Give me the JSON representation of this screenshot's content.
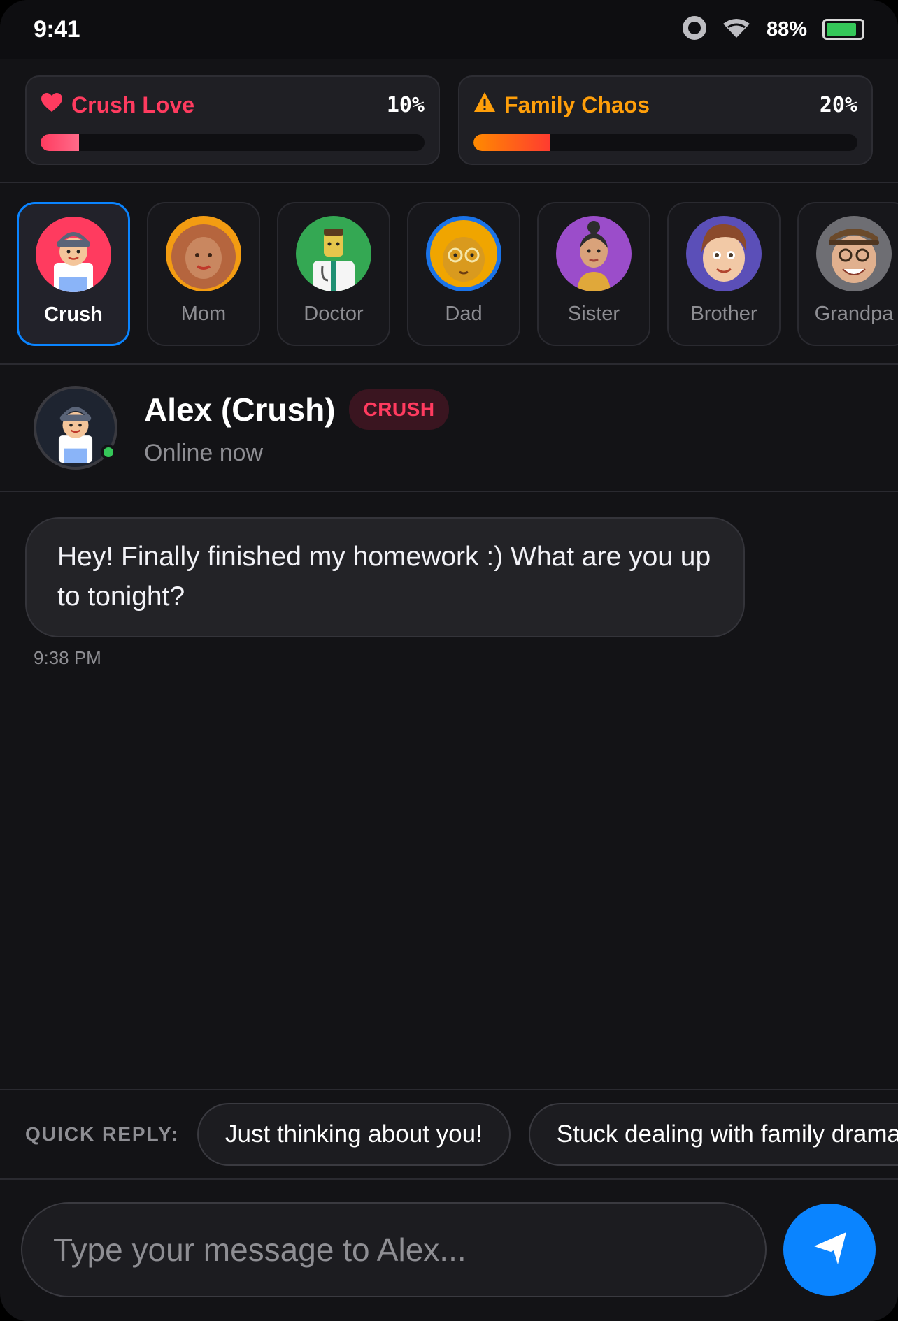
{
  "status_bar": {
    "time": "9:41",
    "battery_pct": "88%",
    "battery_level": 0.88
  },
  "meters": [
    {
      "label": "Crush Love",
      "pct_text": "10%",
      "value": 10,
      "icon": "heart-icon",
      "color": "#ff3b5f"
    },
    {
      "label": "Family Chaos",
      "pct_text": "20%",
      "value": 20,
      "icon": "warning-icon",
      "color": "#ff9f0a"
    }
  ],
  "contacts": [
    {
      "name": "Crush",
      "active": true
    },
    {
      "name": "Mom",
      "active": false
    },
    {
      "name": "Doctor",
      "active": false
    },
    {
      "name": "Dad",
      "active": false
    },
    {
      "name": "Sister",
      "active": false
    },
    {
      "name": "Brother",
      "active": false
    },
    {
      "name": "Grandpa",
      "active": false
    }
  ],
  "chat_header": {
    "name": "Alex (Crush)",
    "badge": "CRUSH",
    "status": "Online now"
  },
  "messages": [
    {
      "text": "Hey! Finally finished my homework :) What are you up to tonight?",
      "time": "9:38 PM"
    }
  ],
  "quick_reply": {
    "label": "QUICK REPLY:",
    "options": [
      "Just thinking about you!",
      "Stuck dealing with family drama..."
    ]
  },
  "composer": {
    "placeholder": "Type your message to Alex..."
  },
  "colors": {
    "accent": "#0a84ff",
    "love": "#ff3b5f",
    "chaos": "#ff9f0a",
    "online": "#35c759"
  }
}
